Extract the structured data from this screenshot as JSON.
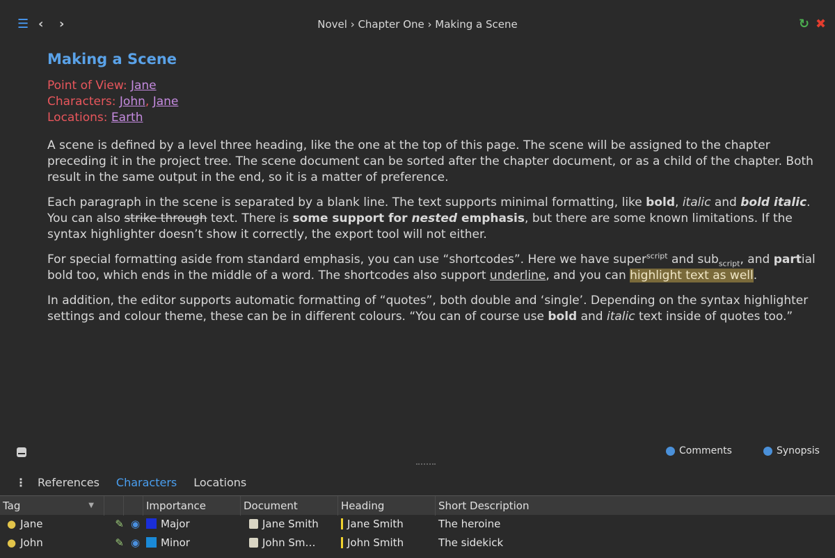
{
  "header": {
    "breadcrumb": "Novel › Chapter One › Making a Scene"
  },
  "document": {
    "title": "Making a Scene",
    "meta": {
      "pov_label": "Point of View:",
      "pov_value": "Jane",
      "characters_label": "Characters:",
      "characters": [
        "John",
        "Jane"
      ],
      "locations_label": "Locations:",
      "location_value": "Earth"
    },
    "p1": "A scene is defined by a level three heading, like the one at the top of this page. The scene will be assigned to the chapter preceding it in the project tree. The scene document can be sorted after the chapter document, or as a child of the chapter. Both result in the same output in the end, so it is a matter of preference.",
    "p2": {
      "a": "Each paragraph in the scene is separated by a blank line. The text supports minimal formatting, like ",
      "bold": "bold",
      "b": ", ",
      "italic": "italic",
      "c": " and ",
      "bolditalic": "bold italic",
      "d": ". You can also ",
      "strike": "strike through",
      "e": " text. There is ",
      "some": "some support for ",
      "nested": "nested",
      "emph": " emphasis",
      "f": ", but there are some known limitations. If the syntax highlighter doesn’t show it correctly, the export tool will not either."
    },
    "p3": {
      "a": "For special formatting aside from standard emphasis, you can use “shortcodes”. Here we have super",
      "sup": "script",
      "b": " and sub",
      "sub": "script",
      "c": ", and ",
      "part": "part",
      "d": "ial bold too, which ends in the middle of a word. The shortcodes also support ",
      "underline": "underline",
      "e": ", and you can ",
      "highlight": "highlight text as well",
      "f": "."
    },
    "p4": {
      "a": "In addition, the editor supports automatic formatting of “quotes”, both double and ‘single’. Depending on the syntax highlighter settings and colour theme, these can be in different colours. “You can of course use ",
      "bold": "bold",
      "b": " and ",
      "italic": "italic",
      "c": " text inside of quotes too.”"
    }
  },
  "editor_footer": {
    "comments": "Comments",
    "synopsis": "Synopsis"
  },
  "panel": {
    "tabs": [
      "References",
      "Characters",
      "Locations"
    ],
    "active_tab": "Characters",
    "columns": [
      "Tag",
      "",
      "",
      "Importance",
      "Document",
      "Heading",
      "Short Description"
    ],
    "rows": [
      {
        "tag": "Jane",
        "importance": "Major",
        "importance_color": "#1a2ed8",
        "document": "Jane Smith",
        "heading": "Jane Smith",
        "description": "The heroine"
      },
      {
        "tag": "John",
        "importance": "Minor",
        "importance_color": "#1a8ad8",
        "document": "John Sm…",
        "heading": "John Smith",
        "description": "The sidekick"
      }
    ]
  },
  "colors": {
    "accent": "#4a9ff0",
    "meta": "#e8565c",
    "link": "#c58be0",
    "heading": "#5aa2e8"
  }
}
